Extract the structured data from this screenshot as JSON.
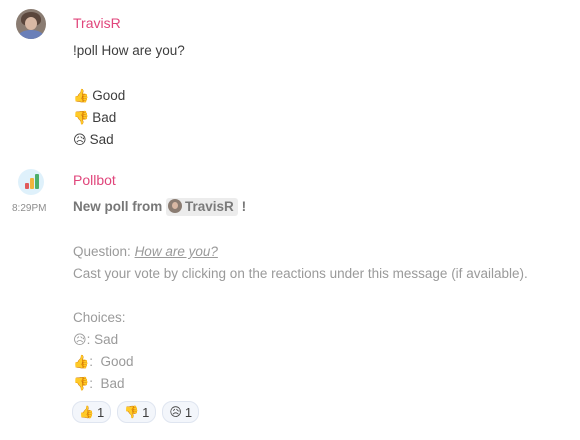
{
  "messages": [
    {
      "author": "TravisR",
      "lines": [
        "!poll How are you?"
      ],
      "options": [
        {
          "icon": "thumbs-up-icon",
          "glyph": "👍",
          "label": "Good"
        },
        {
          "icon": "thumbs-down-icon",
          "glyph": "👎",
          "label": "Bad"
        },
        {
          "icon": "disappointed-relieved-icon",
          "glyph": "😥",
          "label": "Sad"
        }
      ]
    },
    {
      "author": "Pollbot",
      "time": "8:29PM",
      "header_prefix": "New poll from",
      "mention": "TravisR",
      "header_suffix": "!",
      "question_label": "Question:",
      "question": "How are you?",
      "instructions": "Cast your vote by clicking on the reactions under this message (if available).",
      "choices_label": "Choices:",
      "choices": [
        {
          "glyph": "😥",
          "label": ": Sad"
        },
        {
          "glyph": "👍",
          "label": ":  Good"
        },
        {
          "glyph": "👎",
          "label": ":  Bad"
        }
      ],
      "reactions": [
        {
          "glyph": "👍",
          "count": "1"
        },
        {
          "glyph": "👎",
          "count": "1"
        },
        {
          "glyph": "😥",
          "count": "1"
        }
      ]
    }
  ],
  "colors": {
    "username": "#e0457b",
    "meta_text": "#9a9a9a",
    "reaction_bg": "#f3f6fb"
  }
}
